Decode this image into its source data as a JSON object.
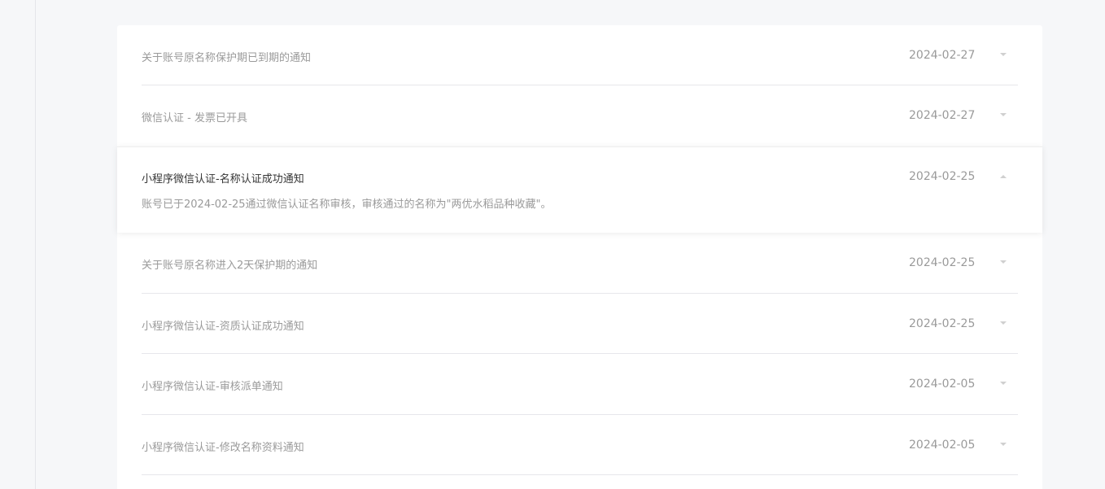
{
  "notifications": [
    {
      "title": "关于账号原名称保护期已到期的通知",
      "date": "2024-02-27",
      "expanded": false
    },
    {
      "title": "微信认证 - 发票已开具",
      "date": "2024-02-27",
      "expanded": false
    },
    {
      "title": "小程序微信认证-名称认证成功通知",
      "date": "2024-02-25",
      "expanded": true,
      "detail": "账号已于2024-02-25通过微信认证名称审核，审核通过的名称为\"两优水稻品种收藏\"。"
    },
    {
      "title": "关于账号原名称进入2天保护期的通知",
      "date": "2024-02-25",
      "expanded": false
    },
    {
      "title": "小程序微信认证-资质认证成功通知",
      "date": "2024-02-25",
      "expanded": false
    },
    {
      "title": "小程序微信认证-审核派单通知",
      "date": "2024-02-05",
      "expanded": false
    },
    {
      "title": "小程序微信认证-修改名称资料通知",
      "date": "2024-02-05",
      "expanded": false
    }
  ],
  "icons": {
    "collapsed": "chevron-down-icon",
    "expanded": "chevron-up-icon"
  }
}
